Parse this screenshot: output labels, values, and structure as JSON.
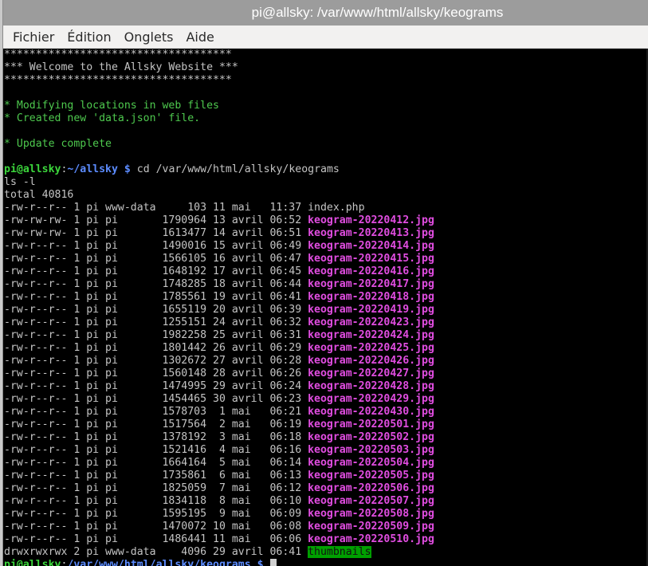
{
  "window": {
    "title": "pi@allsky: /var/www/html/allsky/keograms"
  },
  "menu": [
    {
      "label": "Fichier"
    },
    {
      "label": "Édition"
    },
    {
      "label": "Onglets"
    },
    {
      "label": "Aide"
    }
  ],
  "terminal": {
    "banner": [
      "************************************",
      "*** Welcome to the Allsky Website ***",
      "************************************"
    ],
    "messages": [
      "* Modifying locations in web files",
      "* Created new 'data.json' file."
    ],
    "update": "* Update complete",
    "prompt": {
      "user_host": "pi@allsky",
      "sep": ":",
      "path": "~/allsky",
      "dollar": " $ ",
      "command": "cd /var/www/html/allsky/keograms"
    },
    "command2": "ls -l",
    "total": "total 40816",
    "listing": [
      {
        "meta": "-rw-r--r-- 1 pi www-data     103 11 mai   11:37 ",
        "name": "index.php",
        "kind": "plain"
      },
      {
        "meta": "-rw-rw-rw- 1 pi pi       1790964 13 avril 06:52 ",
        "name": "keogram-20220412.jpg",
        "kind": "image"
      },
      {
        "meta": "-rw-rw-rw- 1 pi pi       1613477 14 avril 06:51 ",
        "name": "keogram-20220413.jpg",
        "kind": "image"
      },
      {
        "meta": "-rw-r--r-- 1 pi pi       1490016 15 avril 06:49 ",
        "name": "keogram-20220414.jpg",
        "kind": "image"
      },
      {
        "meta": "-rw-r--r-- 1 pi pi       1566105 16 avril 06:47 ",
        "name": "keogram-20220415.jpg",
        "kind": "image"
      },
      {
        "meta": "-rw-r--r-- 1 pi pi       1648192 17 avril 06:45 ",
        "name": "keogram-20220416.jpg",
        "kind": "image"
      },
      {
        "meta": "-rw-r--r-- 1 pi pi       1748285 18 avril 06:44 ",
        "name": "keogram-20220417.jpg",
        "kind": "image"
      },
      {
        "meta": "-rw-r--r-- 1 pi pi       1785561 19 avril 06:41 ",
        "name": "keogram-20220418.jpg",
        "kind": "image"
      },
      {
        "meta": "-rw-r--r-- 1 pi pi       1655119 20 avril 06:39 ",
        "name": "keogram-20220419.jpg",
        "kind": "image"
      },
      {
        "meta": "-rw-r--r-- 1 pi pi       1255151 24 avril 06:32 ",
        "name": "keogram-20220423.jpg",
        "kind": "image"
      },
      {
        "meta": "-rw-r--r-- 1 pi pi       1982258 25 avril 06:31 ",
        "name": "keogram-20220424.jpg",
        "kind": "image"
      },
      {
        "meta": "-rw-r--r-- 1 pi pi       1801442 26 avril 06:29 ",
        "name": "keogram-20220425.jpg",
        "kind": "image"
      },
      {
        "meta": "-rw-r--r-- 1 pi pi       1302672 27 avril 06:28 ",
        "name": "keogram-20220426.jpg",
        "kind": "image"
      },
      {
        "meta": "-rw-r--r-- 1 pi pi       1560148 28 avril 06:26 ",
        "name": "keogram-20220427.jpg",
        "kind": "image"
      },
      {
        "meta": "-rw-r--r-- 1 pi pi       1474995 29 avril 06:24 ",
        "name": "keogram-20220428.jpg",
        "kind": "image"
      },
      {
        "meta": "-rw-r--r-- 1 pi pi       1454465 30 avril 06:23 ",
        "name": "keogram-20220429.jpg",
        "kind": "image"
      },
      {
        "meta": "-rw-r--r-- 1 pi pi       1578703  1 mai   06:21 ",
        "name": "keogram-20220430.jpg",
        "kind": "image"
      },
      {
        "meta": "-rw-r--r-- 1 pi pi       1517564  2 mai   06:19 ",
        "name": "keogram-20220501.jpg",
        "kind": "image"
      },
      {
        "meta": "-rw-r--r-- 1 pi pi       1378192  3 mai   06:18 ",
        "name": "keogram-20220502.jpg",
        "kind": "image"
      },
      {
        "meta": "-rw-r--r-- 1 pi pi       1521416  4 mai   06:16 ",
        "name": "keogram-20220503.jpg",
        "kind": "image"
      },
      {
        "meta": "-rw-r--r-- 1 pi pi       1664164  5 mai   06:14 ",
        "name": "keogram-20220504.jpg",
        "kind": "image"
      },
      {
        "meta": "-rw-r--r-- 1 pi pi       1735861  6 mai   06:13 ",
        "name": "keogram-20220505.jpg",
        "kind": "image"
      },
      {
        "meta": "-rw-r--r-- 1 pi pi       1825059  7 mai   06:12 ",
        "name": "keogram-20220506.jpg",
        "kind": "image"
      },
      {
        "meta": "-rw-r--r-- 1 pi pi       1834118  8 mai   06:10 ",
        "name": "keogram-20220507.jpg",
        "kind": "image"
      },
      {
        "meta": "-rw-r--r-- 1 pi pi       1595195  9 mai   06:09 ",
        "name": "keogram-20220508.jpg",
        "kind": "image"
      },
      {
        "meta": "-rw-r--r-- 1 pi pi       1470072 10 mai   06:08 ",
        "name": "keogram-20220509.jpg",
        "kind": "image"
      },
      {
        "meta": "-rw-r--r-- 1 pi pi       1486441 11 mai   06:06 ",
        "name": "keogram-20220510.jpg",
        "kind": "image"
      },
      {
        "meta": "drwxrwxrwx 2 pi www-data    4096 29 avril 06:41 ",
        "name": "thumbnails",
        "kind": "dir"
      }
    ],
    "last_prompt": {
      "user_host": "pi@allsky",
      "sep": ":",
      "path": "/var/www/html/allsky/keograms",
      "dollar": " $ "
    }
  }
}
